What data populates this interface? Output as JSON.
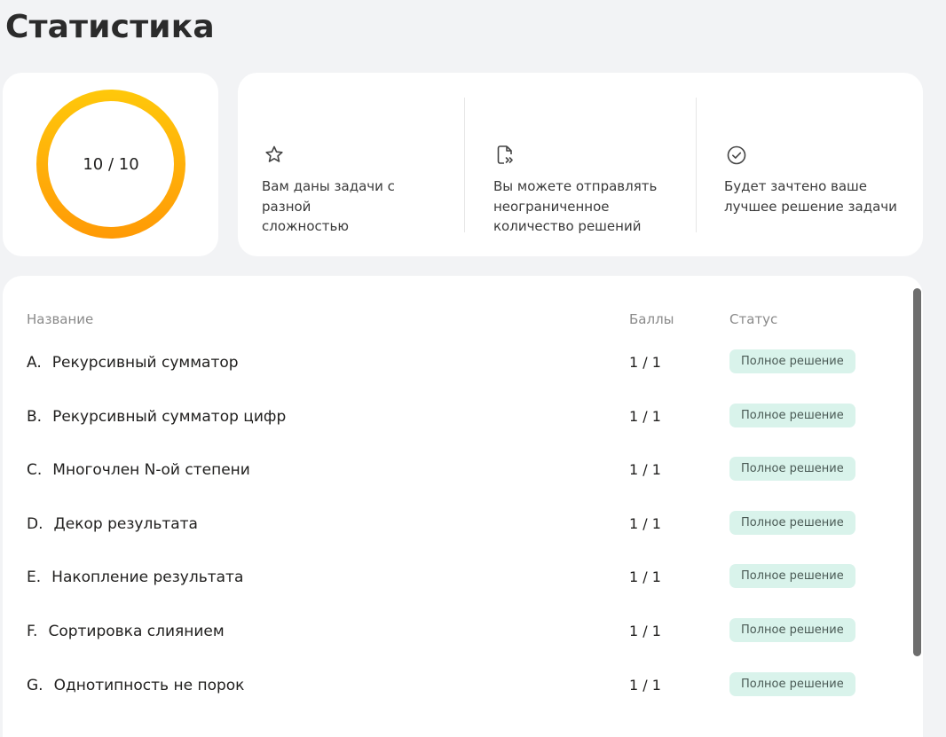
{
  "page": {
    "title": "Статистика"
  },
  "score": {
    "value": "10 / 10",
    "fraction": 1.0
  },
  "info": [
    {
      "icon": "star-icon",
      "text_line1": "Вам даны задачи с разной",
      "text_line2": "сложностью",
      "text_line3": ""
    },
    {
      "icon": "file-send-icon",
      "text_line1": "Вы можете отправлять",
      "text_line2": "неограниченное",
      "text_line3": "количество решений"
    },
    {
      "icon": "check-circle-icon",
      "text_line1": "Будет зачтено ваше",
      "text_line2": "лучшее решение задачи",
      "text_line3": ""
    }
  ],
  "table": {
    "headers": {
      "name": "Название",
      "score": "Баллы",
      "status": "Статус"
    },
    "rows": [
      {
        "letter": "A.",
        "name": "Рекурсивный сумматор",
        "score": "1 / 1",
        "status": "Полное решение"
      },
      {
        "letter": "B.",
        "name": "Рекурсивный сумматор цифр",
        "score": "1 / 1",
        "status": "Полное решение"
      },
      {
        "letter": "C.",
        "name": "Многочлен N-ой степени",
        "score": "1 / 1",
        "status": "Полное решение"
      },
      {
        "letter": "D.",
        "name": "Декор результата",
        "score": "1 / 1",
        "status": "Полное решение"
      },
      {
        "letter": "E.",
        "name": "Накопление результата",
        "score": "1 / 1",
        "status": "Полное решение"
      },
      {
        "letter": "F.",
        "name": "Сортировка слиянием",
        "score": "1 / 1",
        "status": "Полное решение"
      },
      {
        "letter": "G.",
        "name": "Однотипность не порок",
        "score": "1 / 1",
        "status": "Полное решение"
      }
    ]
  },
  "colors": {
    "ring_top": "#ffc80a",
    "ring_bottom": "#ff9a05",
    "badge_bg": "#d9f3eb"
  }
}
